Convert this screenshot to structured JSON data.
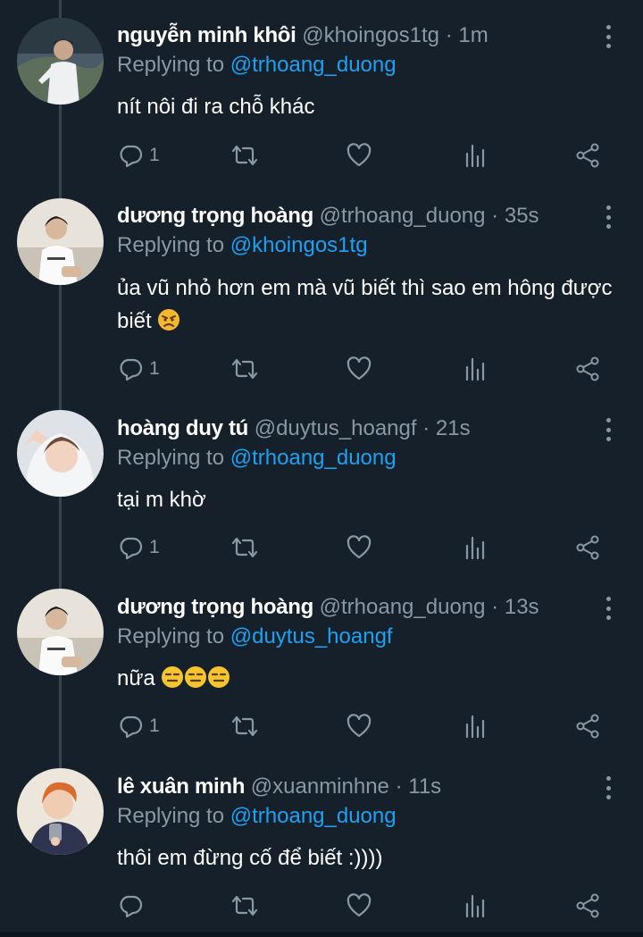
{
  "tweets": [
    {
      "name": "nguyễn minh khôi",
      "handle": "@khoingos1tg",
      "time": "1m",
      "replying_label": "Replying to",
      "replying_to": "@trhoang_duong",
      "text": "nít nôi đi ra chỗ khác",
      "reply_count": "1"
    },
    {
      "name": "dương trọng hoàng",
      "handle": "@trhoang_duong",
      "time": "35s",
      "replying_label": "Replying to",
      "replying_to": "@khoingos1tg",
      "text": "ủa vũ nhỏ hơn em mà vũ biết thì sao em hông được biết",
      "emoji": "angry-face",
      "reply_count": "1"
    },
    {
      "name": "hoàng duy tú",
      "handle": "@duytus_hoangf",
      "time": "21s",
      "replying_label": "Replying to",
      "replying_to": "@trhoang_duong",
      "text": "tại m khờ",
      "reply_count": "1"
    },
    {
      "name": "dương trọng hoàng",
      "handle": "@trhoang_duong",
      "time": "13s",
      "replying_label": "Replying to",
      "replying_to": "@duytus_hoangf",
      "text": "nữa",
      "emoji": "expressionless-face x3",
      "reply_count": "1"
    },
    {
      "name": "lê xuân minh",
      "handle": "@xuanminhne",
      "time": "11s",
      "replying_label": "Replying to",
      "replying_to": "@trhoang_duong",
      "text": "thôi em đừng cố để biết :))))",
      "reply_count": ""
    }
  ],
  "separator": "·",
  "icons": [
    "reply-icon",
    "retweet-icon",
    "like-icon",
    "analytics-icon",
    "share-icon",
    "more-options-icon"
  ],
  "colors": {
    "background": "#15202b",
    "muted": "#8899a6",
    "link": "#1da1f2",
    "thread_line": "#38444d"
  }
}
